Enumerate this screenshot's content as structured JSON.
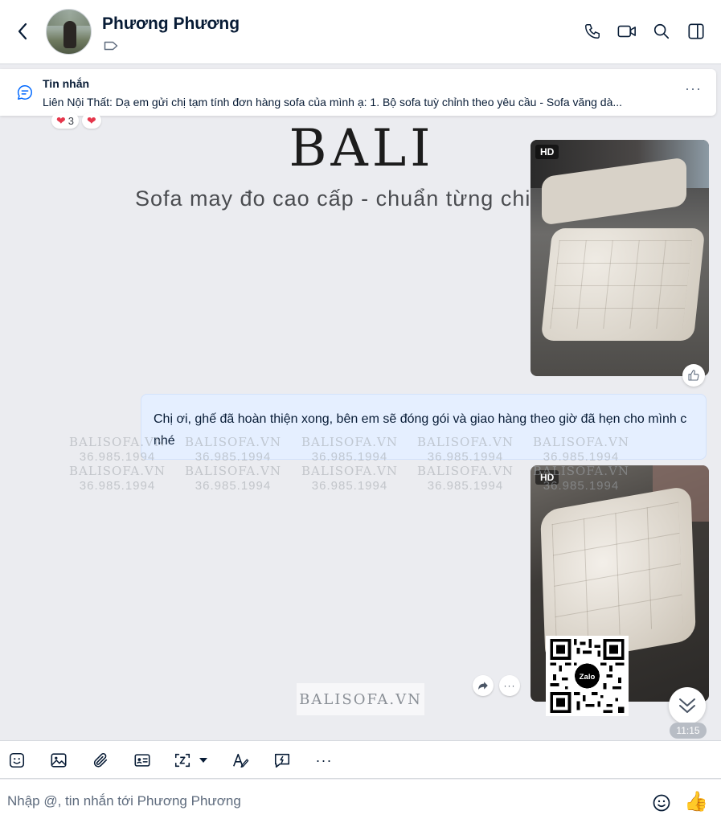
{
  "header": {
    "contact_name": "Phương Phương",
    "icons": [
      "back-icon",
      "tag-icon",
      "phone-icon",
      "video-icon",
      "search-icon",
      "panel-icon"
    ]
  },
  "pinned": {
    "title": "Tin nhắn",
    "text": "Liên Nội Thất: Dạ em gửi chị tạm tính đơn hàng sofa của mình ạ: 1. Bộ sofa tuỳ chỉnh theo yêu cầu - Sofa văng dà...",
    "more": "···"
  },
  "reactions": {
    "heart_count": "3"
  },
  "promo": {
    "brand": "BALI",
    "tagline": "Sofa may đo cao cấp - chuẩn từng chi tiết"
  },
  "images": {
    "hd_label": "HD"
  },
  "message": {
    "text": "Chị ơi, ghế đã hoàn thiện xong, bên em sẽ đóng gói và giao hàng theo giờ đã hẹn cho mình c nhé"
  },
  "watermark": {
    "site": "BALISOFA.VN",
    "phone": "36.985.1994",
    "box_text": "BALISOFA.VN",
    "qr_label": "Zalo"
  },
  "timestamp": "11:15",
  "more_dots": "···",
  "composer": {
    "placeholder": "Nhập @, tin nhắn tới Phương Phương",
    "send_emoji": "👍"
  },
  "colors": {
    "chat_bg": "#ebecf0",
    "bubble_bg": "#e5efff",
    "text": "#081c36",
    "heart": "#e5364b"
  }
}
